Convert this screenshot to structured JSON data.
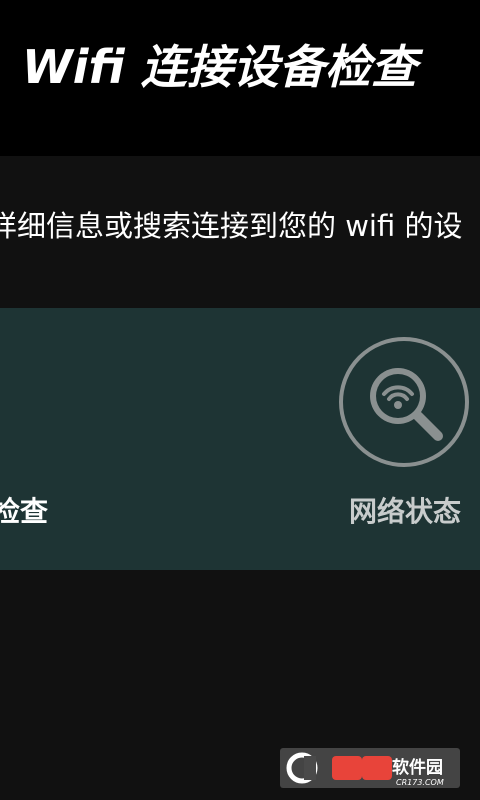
{
  "header": {
    "title": "Wifi 连接设备检查"
  },
  "description": {
    "text": "详细信息或搜索连接到您的 wifi 的设"
  },
  "tiles": {
    "left": {
      "label": "检查"
    },
    "right": {
      "label": "网络状态",
      "icon": "wifi-search-icon"
    }
  },
  "watermark": {
    "text": "软件园",
    "sub": "CR173.COM"
  },
  "colors": {
    "header_bg": "#000000",
    "page_bg": "#111111",
    "tile_bg": "#1e3434",
    "icon_gray": "#8a9090"
  }
}
